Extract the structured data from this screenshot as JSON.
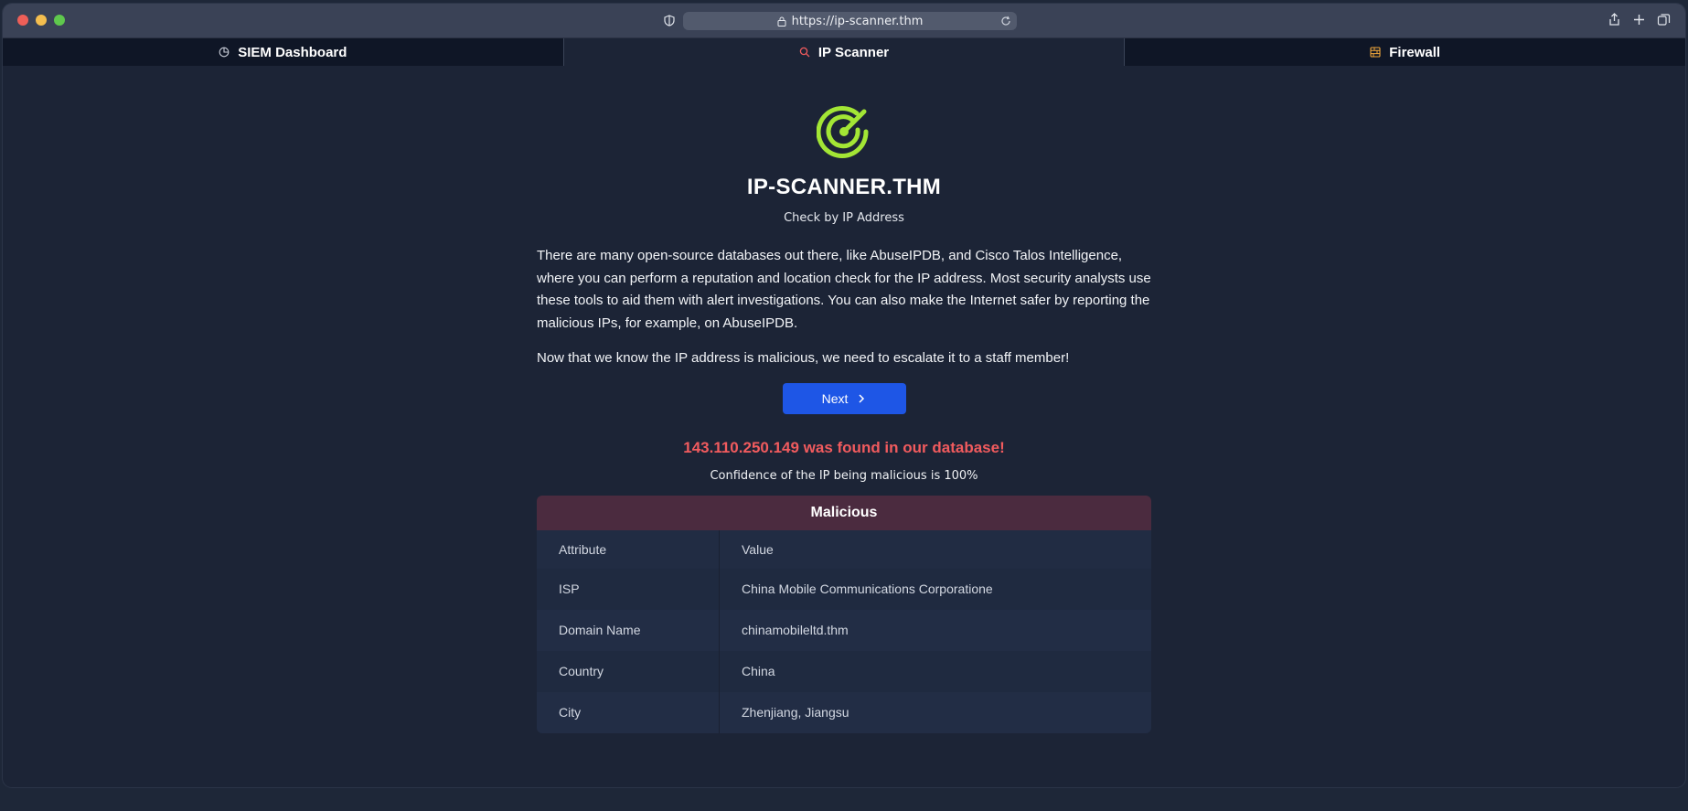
{
  "browser": {
    "url": "https://ip-scanner.thm"
  },
  "tabs": [
    {
      "label": "SIEM Dashboard",
      "icon": "pie-chart-icon"
    },
    {
      "label": "IP Scanner",
      "icon": "search-icon",
      "active": true
    },
    {
      "label": "Firewall",
      "icon": "firewall-icon"
    }
  ],
  "main": {
    "title": "IP-SCANNER.THM",
    "subtitle": "Check by IP Address",
    "paragraph1": "There are many open-source databases out there, like AbuseIPDB, and Cisco Talos Intelligence, where you can perform a reputation and location check for the IP address. Most security analysts use these tools to aid them with alert investigations. You can also make the Internet safer by reporting the malicious IPs, for example, on AbuseIPDB.",
    "paragraph2": "Now that we know the IP address is malicious, we need to escalate it to a staff member!",
    "next_label": "Next",
    "found_message": "143.110.250.149 was found in our database!",
    "confidence": "Confidence of the IP being malicious is 100%"
  },
  "result_table": {
    "heading": "Malicious",
    "columns": [
      "Attribute",
      "Value"
    ],
    "rows": [
      [
        "ISP",
        "China Mobile Communications Corporatione"
      ],
      [
        "Domain Name",
        "chinamobileltd.thm"
      ],
      [
        "Country",
        "China"
      ],
      [
        "City",
        "Zhenjiang, Jiangsu"
      ]
    ]
  },
  "colors": {
    "accent": "#1e56e6",
    "danger": "#f15b5e",
    "logo": "#a3e635",
    "table_heading_bg": "#4b2b3f"
  }
}
